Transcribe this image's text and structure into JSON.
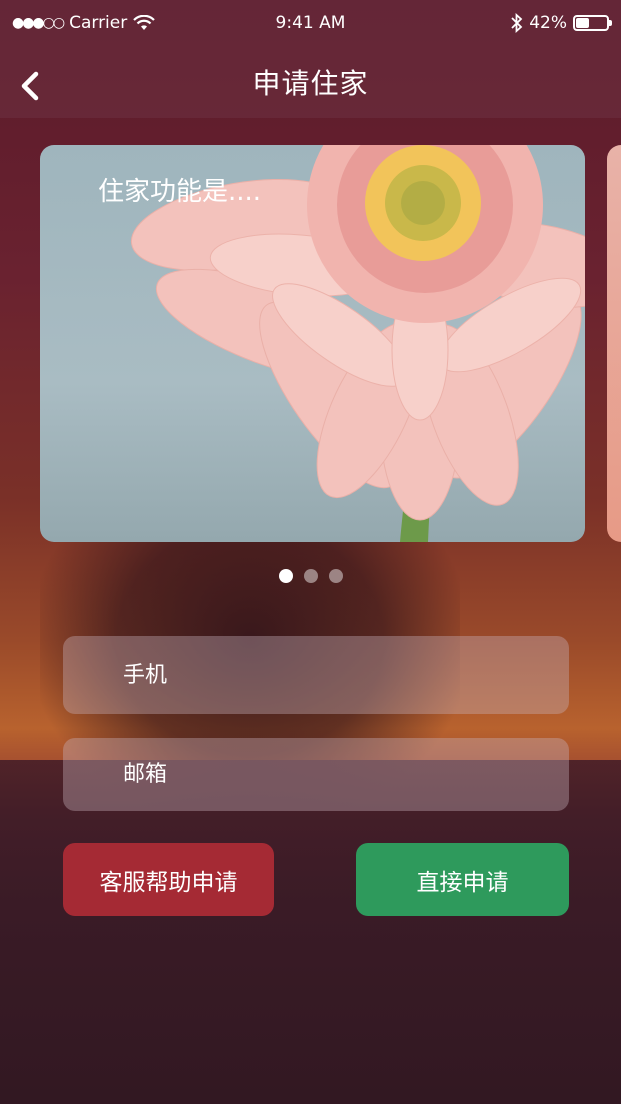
{
  "status_bar": {
    "carrier": "Carrier",
    "time": "9:41 AM",
    "battery": "42%",
    "battery_level": 0.42
  },
  "nav": {
    "title": "申请住家"
  },
  "carousel": {
    "card_text": "住家功能是....",
    "page_count": 3,
    "active_index": 0
  },
  "form": {
    "phone_placeholder": "手机",
    "email_placeholder": "邮箱"
  },
  "buttons": {
    "help_label": "客服帮助申请",
    "apply_label": "直接申请"
  },
  "colors": {
    "help_button": "#a52a34",
    "apply_button": "#2e9a5c"
  }
}
